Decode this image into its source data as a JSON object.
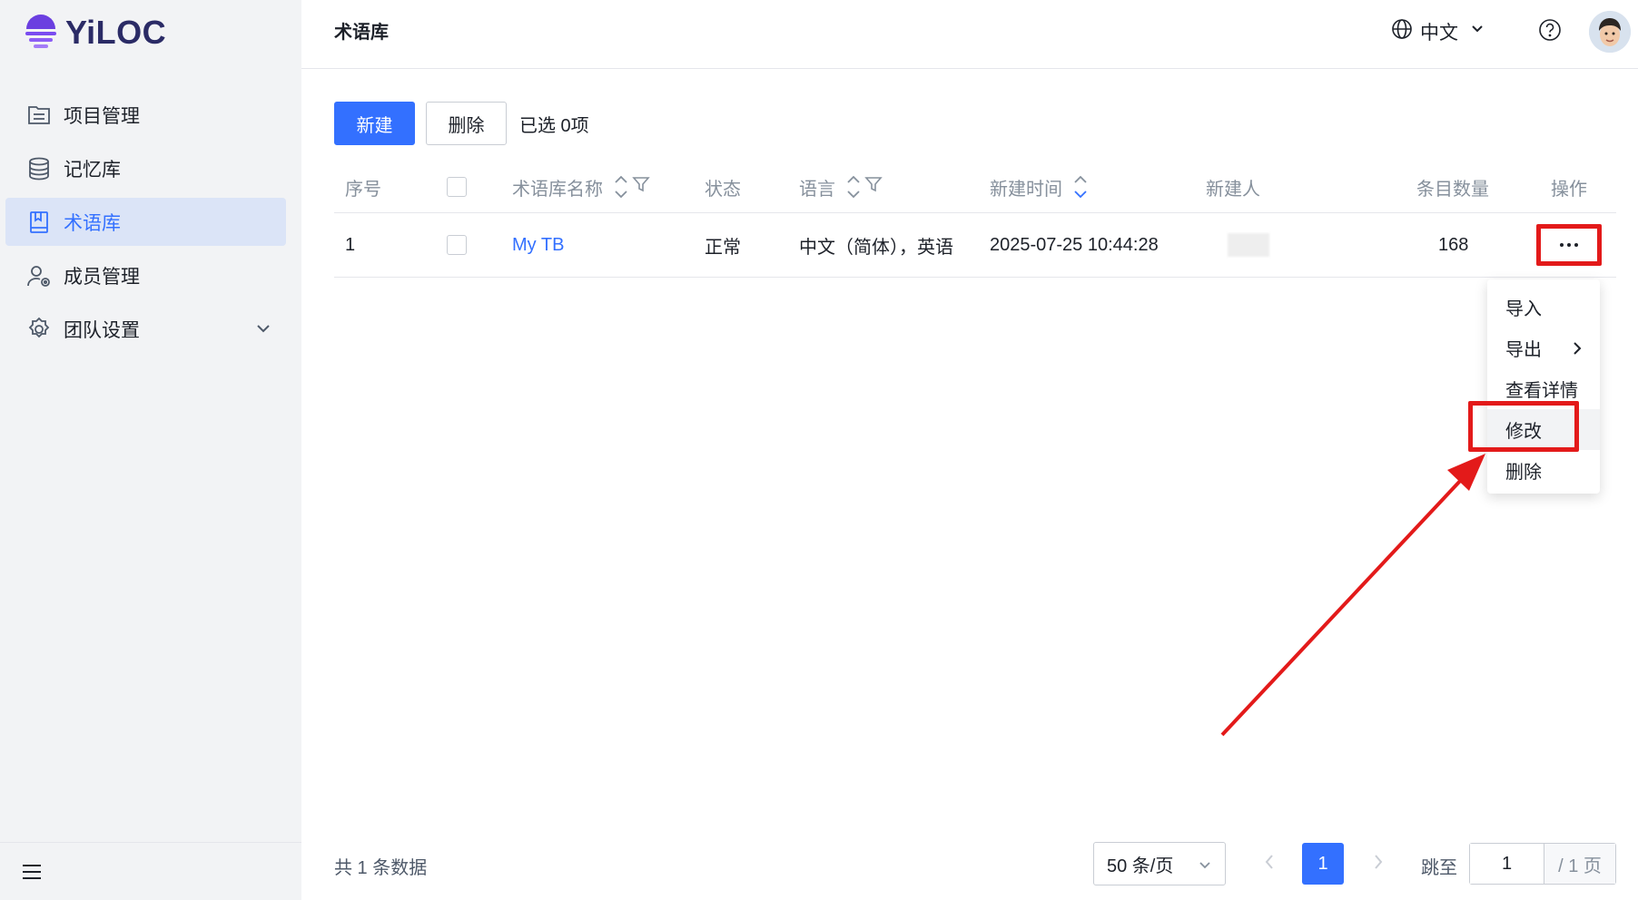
{
  "app": {
    "logo_text": "YiLOC"
  },
  "sidebar": {
    "items": [
      {
        "label": "项目管理",
        "icon": "list-icon"
      },
      {
        "label": "记忆库",
        "icon": "database-icon"
      },
      {
        "label": "术语库",
        "icon": "book-icon",
        "active": true
      },
      {
        "label": "成员管理",
        "icon": "member-settings-icon"
      },
      {
        "label": "团队设置",
        "icon": "gear-icon"
      }
    ]
  },
  "header": {
    "title": "术语库",
    "language": "中文"
  },
  "toolbar": {
    "new_label": "新建",
    "delete_label": "删除",
    "selected": "已选 0项"
  },
  "table": {
    "columns": [
      "序号",
      "",
      "术语库名称",
      "状态",
      "语言",
      "新建时间",
      "新建人",
      "条目数量",
      "操作"
    ],
    "rows": [
      {
        "index": "1",
        "name": "My TB",
        "status": "正常",
        "languages": "中文（简体），英语",
        "created": "2025-07-25 10:44:28",
        "creator": "",
        "count": "168"
      }
    ]
  },
  "dropdown": {
    "items": [
      "导入",
      "导出",
      "查看详情",
      "修改",
      "删除"
    ]
  },
  "footer": {
    "total": "共 1 条数据",
    "page_size": "50 条/页",
    "current_page": "1",
    "jump_label": "跳至",
    "jump_value": "1",
    "total_pages": "/ 1 页"
  },
  "colors": {
    "primary": "#3370ff",
    "annotation": "#e31a1a",
    "sidebar_bg": "#f2f3f5",
    "active_bg": "#dbe4f7"
  }
}
